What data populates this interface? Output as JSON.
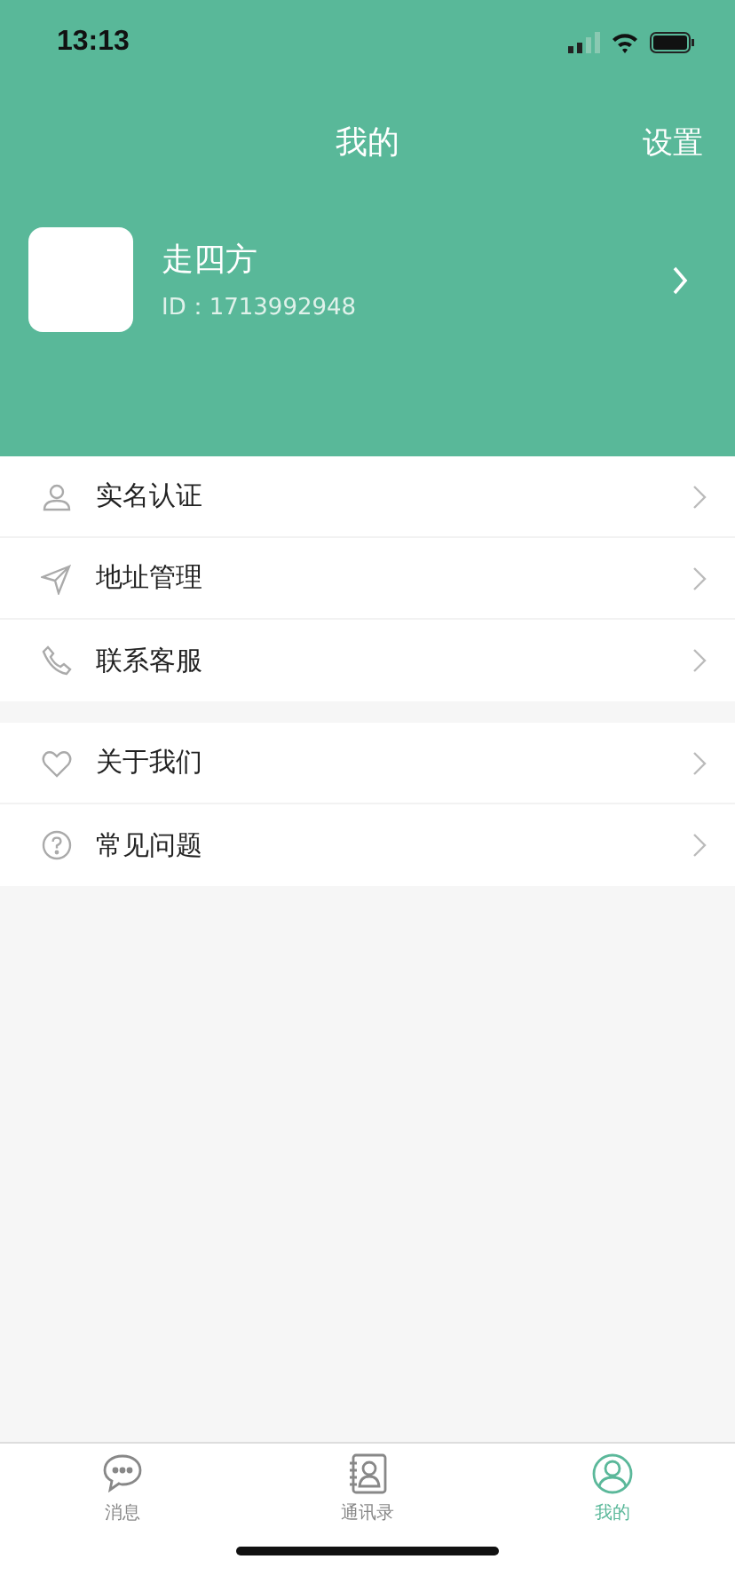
{
  "status_bar": {
    "time": "13:13"
  },
  "header": {
    "title": "我的",
    "action": "设置"
  },
  "profile": {
    "name": "走四方",
    "id": "ID：1713992948"
  },
  "menu_groups": [
    {
      "items": [
        {
          "kind": "person",
          "label": "实名认证"
        },
        {
          "kind": "send",
          "label": "地址管理"
        },
        {
          "kind": "phone",
          "label": "联系客服"
        }
      ]
    },
    {
      "items": [
        {
          "kind": "heart",
          "label": "关于我们"
        },
        {
          "kind": "question",
          "label": "常见问题"
        }
      ]
    }
  ],
  "tabs": [
    {
      "kind": "chat",
      "label": "消息",
      "selected": false
    },
    {
      "kind": "contacts",
      "label": "通讯录",
      "selected": false
    },
    {
      "kind": "me",
      "label": "我的",
      "selected": true
    }
  ]
}
